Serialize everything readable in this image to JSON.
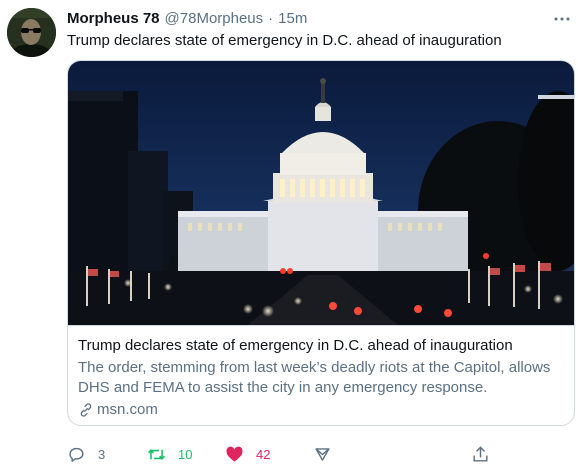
{
  "author": {
    "name": "Morpheus 78",
    "handle": "@78Morpheus",
    "separator": "·",
    "time": "15m"
  },
  "tweet": {
    "text": "Trump declares state of emergency in D.C. ahead of inauguration"
  },
  "card": {
    "title": "Trump declares state of emergency in D.C. ahead of inauguration",
    "description": "The order, stemming from last week’s deadly riots at the Capitol, allows DHS and FEMA to assist the city in any emergency response.",
    "domain": "msn.com"
  },
  "actions": {
    "reply_count": "3",
    "retweet_count": "10",
    "like_count": "42"
  },
  "colors": {
    "retweet_active": "#17bf63",
    "like_active": "#e0245e",
    "secondary_text": "#5b7083",
    "border": "#cfd9de"
  },
  "icons": [
    "more-icon",
    "link-icon",
    "reply-icon",
    "retweet-icon",
    "heart-icon",
    "share-icon",
    "upload-icon"
  ]
}
